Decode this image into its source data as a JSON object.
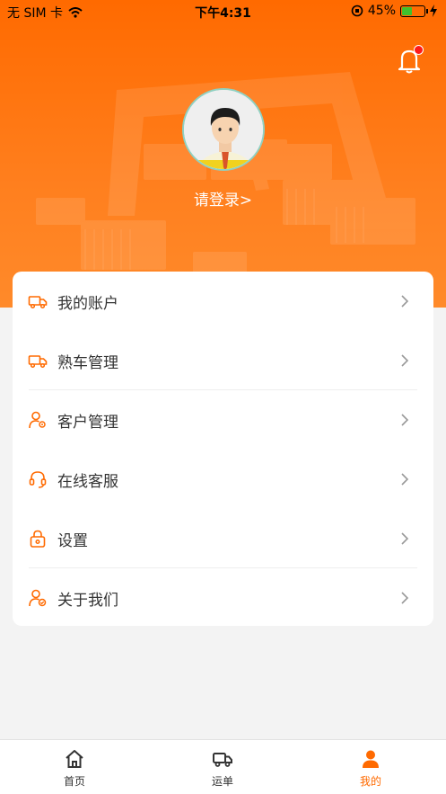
{
  "status_bar": {
    "carrier": "无 SIM 卡",
    "time": "下午4:31",
    "battery": "45%",
    "battery_level": 0.45
  },
  "header": {
    "login_text": "请登录>",
    "notification_unread": true
  },
  "menu": {
    "items": [
      {
        "label": "我的账户",
        "icon": "truck-icon"
      },
      {
        "label": "熟车管理",
        "icon": "truck-icon"
      },
      {
        "label": "客户管理",
        "icon": "user-gear-icon"
      },
      {
        "label": "在线客服",
        "icon": "headset-icon"
      },
      {
        "label": "设置",
        "icon": "lock-icon"
      },
      {
        "label": "关于我们",
        "icon": "user-check-icon"
      }
    ]
  },
  "tabbar": {
    "tabs": [
      {
        "label": "首页",
        "icon": "home-icon",
        "active": false
      },
      {
        "label": "运单",
        "icon": "truck-icon",
        "active": false
      },
      {
        "label": "我的",
        "icon": "person-icon",
        "active": true
      }
    ]
  },
  "colors": {
    "accent": "#ff6a00",
    "header_bg": "#ff7a1a",
    "background": "#f3f3f3",
    "badge": "#ff1a1a"
  }
}
